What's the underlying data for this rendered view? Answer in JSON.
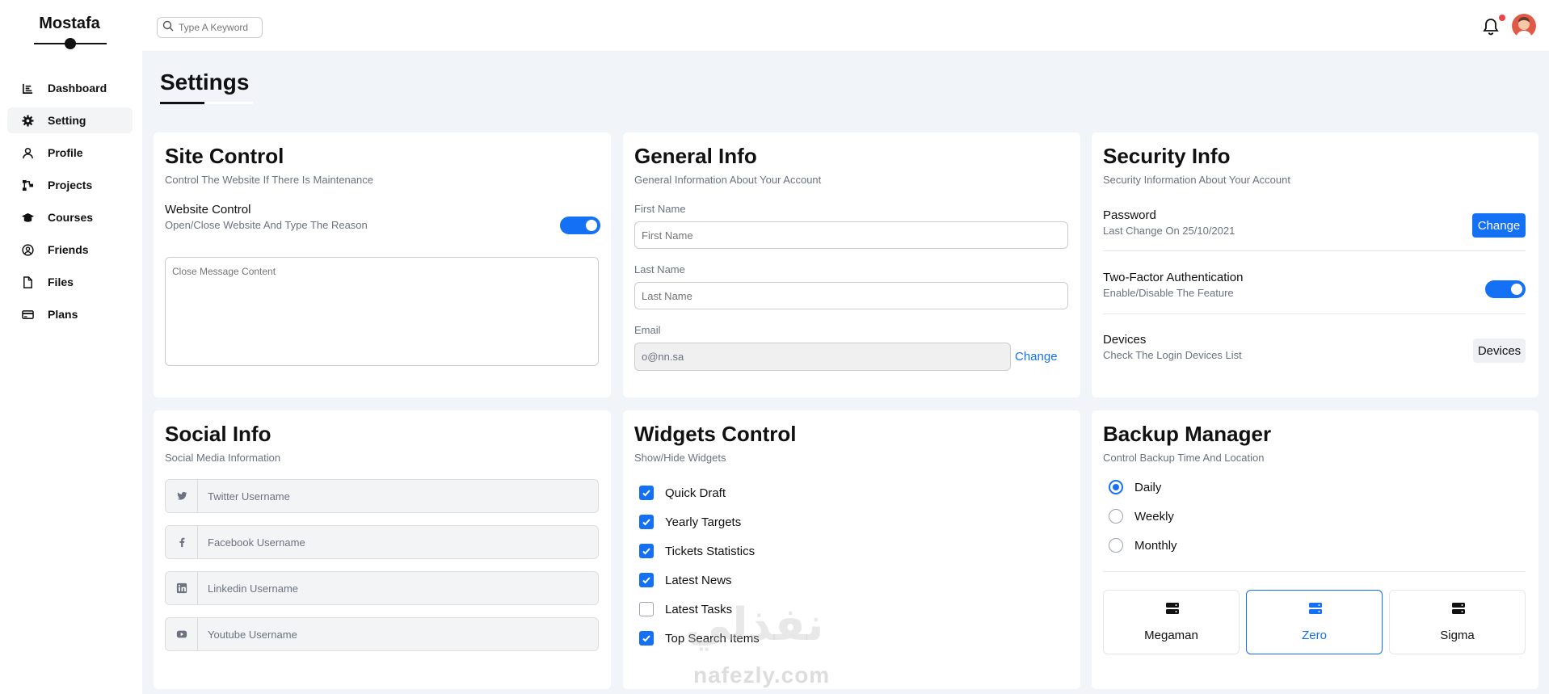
{
  "sidebar": {
    "brand": "Mostafa",
    "items": [
      {
        "label": "Dashboard",
        "icon": "chart-line-icon",
        "active": false
      },
      {
        "label": "Setting",
        "icon": "gear-icon",
        "active": true
      },
      {
        "label": "Profile",
        "icon": "user-icon",
        "active": false
      },
      {
        "label": "Projects",
        "icon": "diagram-icon",
        "active": false
      },
      {
        "label": "Courses",
        "icon": "graduation-cap-icon",
        "active": false
      },
      {
        "label": "Friends",
        "icon": "user-circle-icon",
        "active": false
      },
      {
        "label": "Files",
        "icon": "file-icon",
        "active": false
      },
      {
        "label": "Plans",
        "icon": "credit-card-icon",
        "active": false
      }
    ]
  },
  "header": {
    "search_placeholder": "Type A Keyword",
    "notification_count_indicator": true
  },
  "page": {
    "title": "Settings"
  },
  "site_control": {
    "title": "Site Control",
    "subtitle": "Control The Website If There Is Maintenance",
    "row_title": "Website Control",
    "row_sub": "Open/Close Website And Type The Reason",
    "toggle_on": true,
    "textarea_placeholder": "Close Message Content"
  },
  "general_info": {
    "title": "General Info",
    "subtitle": "General Information About Your Account",
    "first_name_label": "First Name",
    "first_name_placeholder": "First Name",
    "last_name_label": "Last Name",
    "last_name_placeholder": "Last Name",
    "email_label": "Email",
    "email_value": "o@nn.sa",
    "change_link": "Change"
  },
  "security_info": {
    "title": "Security Info",
    "subtitle": "Security Information About Your Account",
    "password_title": "Password",
    "password_sub": "Last Change On 25/10/2021",
    "password_button": "Change",
    "tfa_title": "Two-Factor Authentication",
    "tfa_sub": "Enable/Disable The Feature",
    "tfa_on": true,
    "devices_title": "Devices",
    "devices_sub": "Check The Login Devices List",
    "devices_button": "Devices"
  },
  "social_info": {
    "title": "Social Info",
    "subtitle": "Social Media Information",
    "fields": [
      {
        "icon": "twitter-icon",
        "placeholder": "Twitter Username"
      },
      {
        "icon": "facebook-icon",
        "placeholder": "Facebook Username"
      },
      {
        "icon": "linkedin-icon",
        "placeholder": "Linkedin Username"
      },
      {
        "icon": "youtube-icon",
        "placeholder": "Youtube Username"
      }
    ]
  },
  "widgets_control": {
    "title": "Widgets Control",
    "subtitle": "Show/Hide Widgets",
    "items": [
      {
        "label": "Quick Draft",
        "checked": true
      },
      {
        "label": "Yearly Targets",
        "checked": true
      },
      {
        "label": "Tickets Statistics",
        "checked": true
      },
      {
        "label": "Latest News",
        "checked": true
      },
      {
        "label": "Latest Tasks",
        "checked": false
      },
      {
        "label": "Top Search Items",
        "checked": true
      }
    ]
  },
  "backup_manager": {
    "title": "Backup Manager",
    "subtitle": "Control Backup Time And Location",
    "options": [
      {
        "label": "Daily",
        "selected": true
      },
      {
        "label": "Weekly",
        "selected": false
      },
      {
        "label": "Monthly",
        "selected": false
      }
    ],
    "servers": [
      {
        "label": "Megaman",
        "active": false
      },
      {
        "label": "Zero",
        "active": true
      },
      {
        "label": "Sigma",
        "active": false
      }
    ]
  },
  "watermark": {
    "latin": "nafezly.com",
    "arabic": "نفذلي"
  },
  "colors": {
    "accent": "#1470f5",
    "background": "#f1f5f9",
    "notification": "#ef4444"
  }
}
